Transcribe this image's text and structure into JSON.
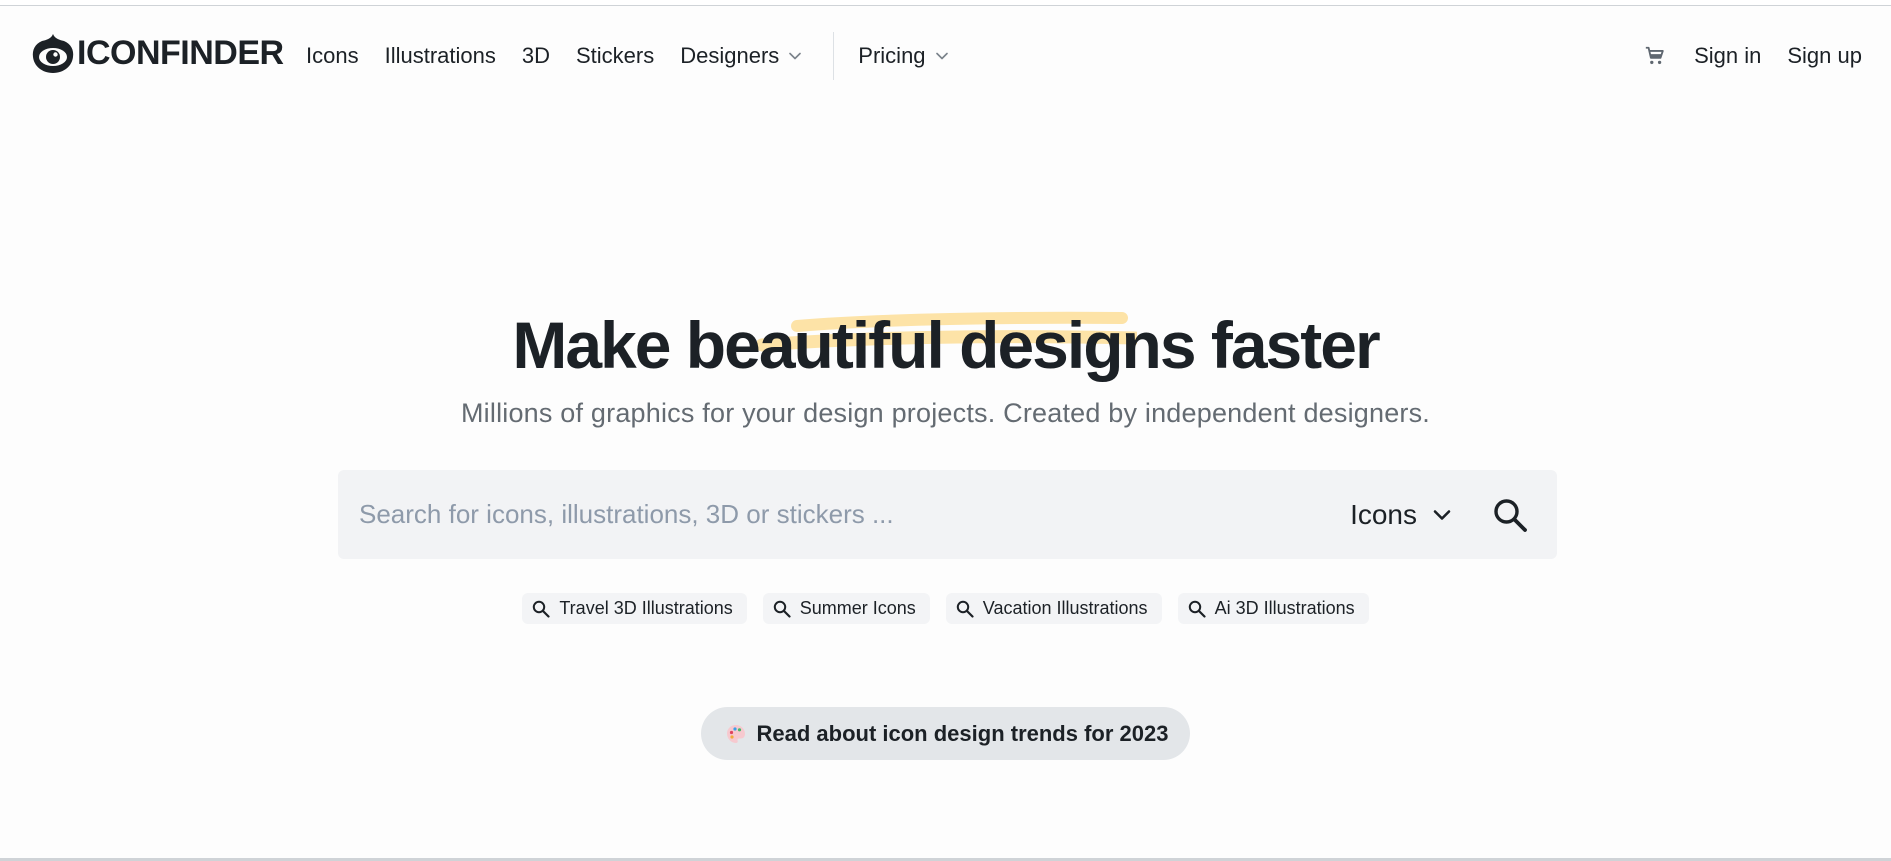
{
  "header": {
    "logo_text": "ICONFINDER",
    "nav": [
      {
        "label": "Icons"
      },
      {
        "label": "Illustrations"
      },
      {
        "label": "3D"
      },
      {
        "label": "Stickers"
      },
      {
        "label": "Designers",
        "dropdown": true
      }
    ],
    "pricing_label": "Pricing",
    "cart_icon": "cart-icon",
    "sign_in": "Sign in",
    "sign_up": "Sign up"
  },
  "hero": {
    "title_prefix": "Make",
    "title_highlight": "beautiful designs",
    "title_suffix": "faster",
    "highlight_color": "#fde3a7",
    "subtitle": "Millions of graphics for your design projects. Created by independent designers."
  },
  "search": {
    "placeholder": "Search for icons, illustrations, 3D or stickers ...",
    "value": "",
    "type_selected": "Icons",
    "button_icon": "search-icon"
  },
  "suggestions": [
    {
      "label": "Travel 3D Illustrations"
    },
    {
      "label": "Summer Icons"
    },
    {
      "label": "Vacation Illustrations"
    },
    {
      "label": "Ai 3D Illustrations"
    }
  ],
  "trend": {
    "icon": "palette-icon",
    "label": "Read about icon design trends for 2023"
  },
  "colors": {
    "text": "#1c2126",
    "muted": "#646b72",
    "search_bg": "#f2f3f5",
    "placeholder": "#8e9aaa",
    "pill_bg": "#e3e6e9"
  }
}
